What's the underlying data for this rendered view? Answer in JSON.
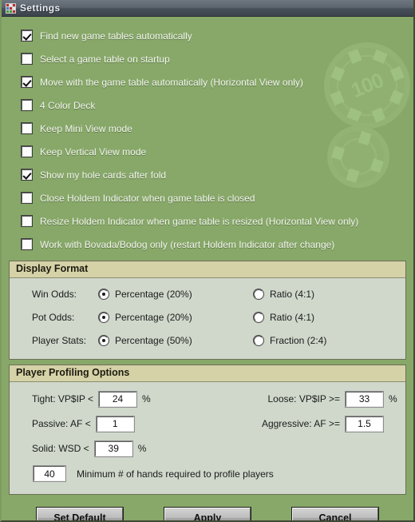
{
  "window": {
    "title": "Settings",
    "icon": "app-grid-icon",
    "background_color": "#87a868",
    "titlebar_color": "#4b535c"
  },
  "watermark": {
    "chips": [
      {
        "label": "100",
        "name": "poker-chip-watermark-large"
      },
      {
        "label": "",
        "name": "poker-chip-watermark-small"
      }
    ]
  },
  "checkboxes": [
    {
      "label": "Find new game tables automatically",
      "checked": true
    },
    {
      "label": "Select a game table on startup",
      "checked": false
    },
    {
      "label": "Move with the game table automatically (Horizontal View only)",
      "checked": true
    },
    {
      "label": "4 Color Deck",
      "checked": false
    },
    {
      "label": "Keep Mini View mode",
      "checked": false
    },
    {
      "label": "Keep Vertical View mode",
      "checked": false
    },
    {
      "label": "Show my hole cards after fold",
      "checked": true
    },
    {
      "label": "Close Holdem Indicator when game table is closed",
      "checked": false
    },
    {
      "label": "Resize Holdem Indicator when game table is resized (Horizontal View only)",
      "checked": false
    },
    {
      "label": "Work with Bovada/Bodog only (restart Holdem Indicator after change)",
      "checked": false
    }
  ],
  "display_format": {
    "title": "Display Format",
    "rows": [
      {
        "label": "Win Odds:",
        "option_a": {
          "label": "Percentage (20%)",
          "selected": true
        },
        "option_b": {
          "label": "Ratio (4:1)",
          "selected": false
        }
      },
      {
        "label": "Pot Odds:",
        "option_a": {
          "label": "Percentage (20%)",
          "selected": true
        },
        "option_b": {
          "label": "Ratio (4:1)",
          "selected": false
        }
      },
      {
        "label": "Player Stats:",
        "option_a": {
          "label": "Percentage (50%)",
          "selected": true
        },
        "option_b": {
          "label": "Fraction (2:4)",
          "selected": false
        }
      }
    ]
  },
  "player_profiling": {
    "title": "Player Profiling Options",
    "tight": {
      "label": "Tight:  VP$IP  <",
      "value": "24",
      "unit": "%"
    },
    "loose": {
      "label": "Loose:    VP$IP  >=",
      "value": "33",
      "unit": "%"
    },
    "passive": {
      "label": "Passive:  AF  <",
      "value": "1",
      "unit": ""
    },
    "aggressive": {
      "label": "Aggressive:  AF  >=",
      "value": "1.5",
      "unit": ""
    },
    "solid": {
      "label": "Solid:  WSD  <",
      "value": "39",
      "unit": "%"
    },
    "minimum_hands": {
      "value": "40",
      "label": "Minimum # of hands required to profile players"
    }
  },
  "buttons": {
    "set_default": "Set Default",
    "apply": "Apply",
    "cancel": "Cancel"
  }
}
